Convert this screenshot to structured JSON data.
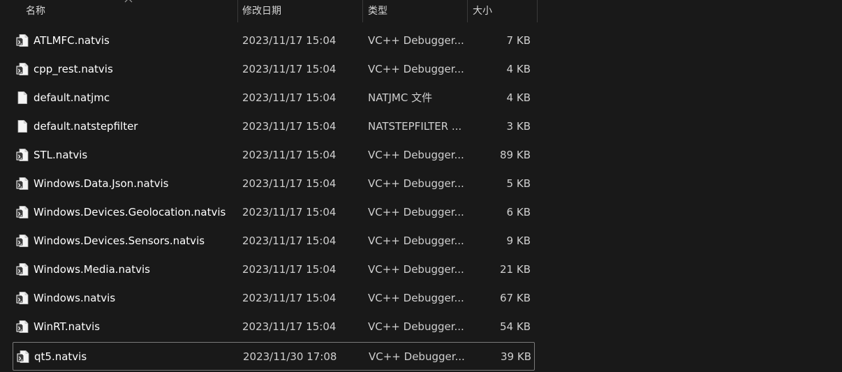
{
  "columns": {
    "name": "名称",
    "date": "修改日期",
    "type": "类型",
    "size": "大小"
  },
  "files": [
    {
      "name": "ATLMFC.natvis",
      "date": "2023/11/17 15:04",
      "type": "VC++ Debugger...",
      "size": "7 KB",
      "icon": "natvis-file-icon"
    },
    {
      "name": "cpp_rest.natvis",
      "date": "2023/11/17 15:04",
      "type": "VC++ Debugger...",
      "size": "4 KB",
      "icon": "natvis-file-icon"
    },
    {
      "name": "default.natjmc",
      "date": "2023/11/17 15:04",
      "type": "NATJMC 文件",
      "size": "4 KB",
      "icon": "blank-file-icon"
    },
    {
      "name": "default.natstepfilter",
      "date": "2023/11/17 15:04",
      "type": "NATSTEPFILTER ...",
      "size": "3 KB",
      "icon": "blank-file-icon"
    },
    {
      "name": "STL.natvis",
      "date": "2023/11/17 15:04",
      "type": "VC++ Debugger...",
      "size": "89 KB",
      "icon": "natvis-file-icon"
    },
    {
      "name": "Windows.Data.Json.natvis",
      "date": "2023/11/17 15:04",
      "type": "VC++ Debugger...",
      "size": "5 KB",
      "icon": "natvis-file-icon"
    },
    {
      "name": "Windows.Devices.Geolocation.natvis",
      "date": "2023/11/17 15:04",
      "type": "VC++ Debugger...",
      "size": "6 KB",
      "icon": "natvis-file-icon"
    },
    {
      "name": "Windows.Devices.Sensors.natvis",
      "date": "2023/11/17 15:04",
      "type": "VC++ Debugger...",
      "size": "9 KB",
      "icon": "natvis-file-icon"
    },
    {
      "name": "Windows.Media.natvis",
      "date": "2023/11/17 15:04",
      "type": "VC++ Debugger...",
      "size": "21 KB",
      "icon": "natvis-file-icon"
    },
    {
      "name": "Windows.natvis",
      "date": "2023/11/17 15:04",
      "type": "VC++ Debugger...",
      "size": "67 KB",
      "icon": "natvis-file-icon"
    },
    {
      "name": "WinRT.natvis",
      "date": "2023/11/17 15:04",
      "type": "VC++ Debugger...",
      "size": "54 KB",
      "icon": "natvis-file-icon"
    },
    {
      "name": "qt5.natvis",
      "date": "2023/11/30 17:08",
      "type": "VC++ Debugger...",
      "size": "39 KB",
      "icon": "natvis-file-icon",
      "selected": true
    }
  ],
  "colors": {
    "background": "#191919",
    "text": "#ffffff",
    "muted_text": "#cfcfcf",
    "selection_border": "#7a7a7a"
  }
}
